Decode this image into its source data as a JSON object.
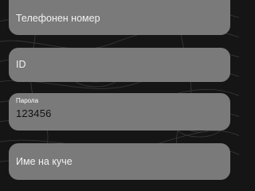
{
  "form": {
    "phone": {
      "placeholder": "Телефонен номер"
    },
    "id_field": {
      "placeholder": "ID"
    },
    "password": {
      "label": "Парола",
      "value": "123456"
    },
    "pet_name": {
      "placeholder": "Име на куче"
    }
  },
  "colors": {
    "background": "#151515",
    "field_fill": "#7a7a7a",
    "text_light": "#f2f2f2",
    "text_dark": "#111111",
    "pattern_lines": "#3a3a3a"
  }
}
